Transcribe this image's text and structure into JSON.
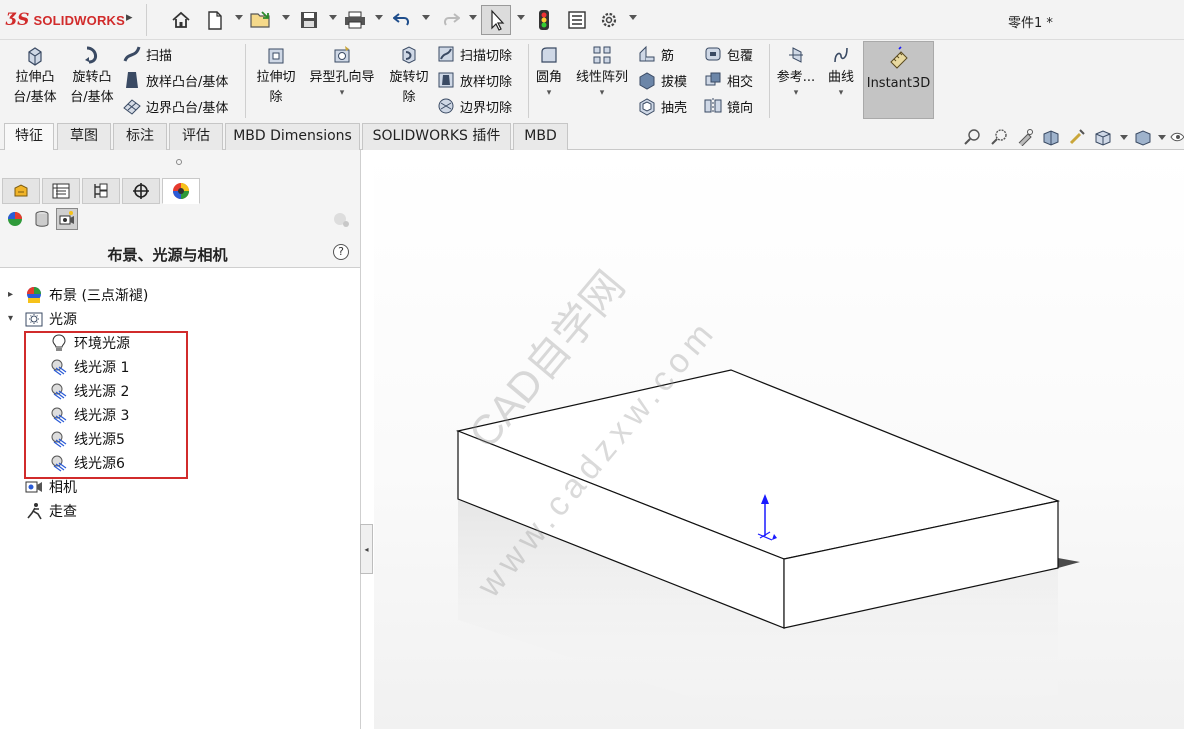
{
  "app": {
    "brand": "SOLIDWORKS",
    "doc_title": "零件1 *"
  },
  "quick_access": {
    "icons": [
      "home-icon",
      "new-document-icon",
      "open-file-icon",
      "save-icon",
      "print-icon",
      "undo-icon",
      "redo-icon",
      "select-pointer-icon",
      "rebuild-traffic-light-icon",
      "file-properties-icon",
      "options-gear-icon"
    ]
  },
  "ribbon": {
    "extrude_boss": "拉伸凸台/基体",
    "extrude_boss_l1": "拉伸凸",
    "extrude_boss_l2": "台/基体",
    "revolve_boss_l1": "旋转凸",
    "revolve_boss_l2": "台/基体",
    "sweep": "扫描",
    "loft_boss": "放样凸台/基体",
    "boundary_boss": "边界凸台/基体",
    "extrude_cut_l1": "拉伸切",
    "extrude_cut_l2": "除",
    "hole_wizard": "异型孔向导",
    "revolve_cut_l1": "旋转切",
    "revolve_cut_l2": "除",
    "sweep_cut": "扫描切除",
    "loft_cut": "放样切除",
    "boundary_cut": "边界切除",
    "fillet": "圆角",
    "linear_pattern": "线性阵列",
    "rib": "筋",
    "draft": "拔模",
    "shell": "抽壳",
    "wrap": "包覆",
    "intersect": "相交",
    "mirror": "镜向",
    "reference": "参考...",
    "curves": "曲线",
    "instant3d": "Instant3D"
  },
  "tabs": [
    {
      "label": "特征"
    },
    {
      "label": "草图"
    },
    {
      "label": "标注"
    },
    {
      "label": "评估"
    },
    {
      "label": "MBD Dimensions"
    },
    {
      "label": "SOLIDWORKS 插件"
    },
    {
      "label": "MBD"
    }
  ],
  "panel": {
    "title": "布景、光源与相机",
    "help": "?",
    "tree": {
      "scene": "布景 (三点渐褪)",
      "lights": "光源",
      "ambient": "环境光源",
      "dir1": "线光源 1",
      "dir2": "线光源 2",
      "dir3": "线光源 3",
      "dir5": "线光源5",
      "dir6": "线光源6",
      "camera": "相机",
      "walkthrough": "走查"
    }
  },
  "watermark": {
    "line1": "CAD自学网",
    "line2": "www.cadzxw.com"
  },
  "colors": {
    "accent_red": "#d12b2b",
    "axis_blue": "#1a1aff"
  }
}
